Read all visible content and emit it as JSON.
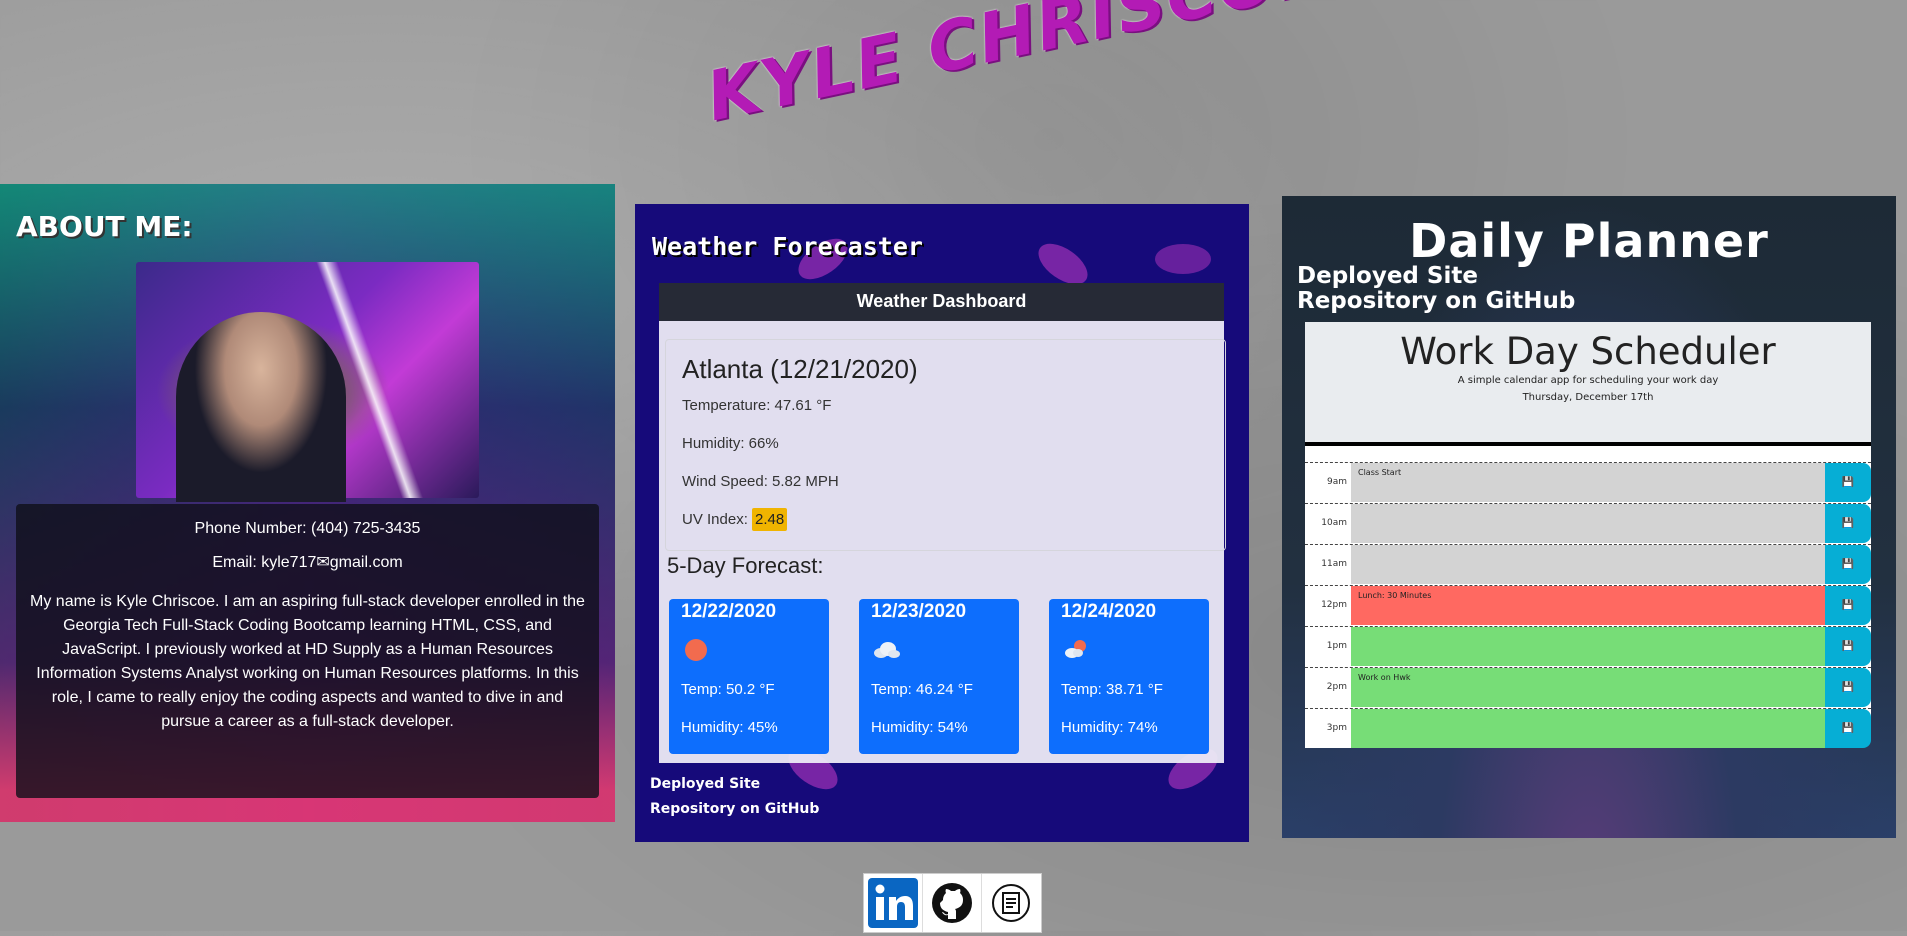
{
  "site": {
    "title": "KYLE CHRISCOE"
  },
  "about": {
    "heading": "ABOUT ME:",
    "phone": "Phone Number: (404) 725-3435",
    "email": "Email: kyle717✉gmail.com",
    "bio": "My name is Kyle Chriscoe. I am an aspiring full-stack developer enrolled in the Georgia Tech Full-Stack Coding Bootcamp learning HTML, CSS, and JavaScript. I previously worked at HD Supply as a Human Resources Information Systems Analyst working on Human Resources platforms. In this role, I came to really enjoy the coding aspects and wanted to dive in and pursue a career as a full-stack developer."
  },
  "weather": {
    "heading": "Weather Forecaster",
    "dashboard_title": "Weather Dashboard",
    "city_date": "Atlanta (12/21/2020)",
    "temperature": "Temperature: 47.61 °F",
    "humidity": "Humidity: 66%",
    "wind": "Wind Speed: 5.82 MPH",
    "uv_label": "UV Index:",
    "uv_value": "2.48",
    "uv_color": "#f0b400",
    "five_day_title": "5-Day Forecast:",
    "forecast": [
      {
        "date": "12/22/2020",
        "icon": "sun-icon",
        "temp": "Temp: 50.2 °F",
        "humidity": "Humidity: 45%"
      },
      {
        "date": "12/23/2020",
        "icon": "cloud-icon",
        "temp": "Temp: 46.24 °F",
        "humidity": "Humidity: 54%"
      },
      {
        "date": "12/24/2020",
        "icon": "partly-cloudy-icon",
        "temp": "Temp: 38.71 °F",
        "humidity": "Humidity: 74%"
      }
    ],
    "links": {
      "deployed": "Deployed Site",
      "repo": "Repository on GitHub"
    }
  },
  "planner": {
    "heading": "Daily Planner",
    "links": {
      "deployed": "Deployed Site",
      "repo": "Repository on GitHub"
    },
    "scheduler": {
      "title": "Work Day Scheduler",
      "subtitle": "A simple calendar app for scheduling your work day",
      "date": "Thursday, December 17th",
      "rows": [
        {
          "hour": "9am",
          "text": "Class Start",
          "state": "past"
        },
        {
          "hour": "10am",
          "text": "",
          "state": "past"
        },
        {
          "hour": "11am",
          "text": "",
          "state": "past"
        },
        {
          "hour": "12pm",
          "text": "Lunch: 30 Minutes",
          "state": "present"
        },
        {
          "hour": "1pm",
          "text": "",
          "state": "future"
        },
        {
          "hour": "2pm",
          "text": "Work on Hwk",
          "state": "future"
        },
        {
          "hour": "3pm",
          "text": "",
          "state": "future"
        }
      ]
    }
  },
  "social": [
    {
      "icon": "linkedin-icon"
    },
    {
      "icon": "github-icon"
    },
    {
      "icon": "resume-icon"
    }
  ],
  "colors": {
    "title": "#b31bb5",
    "weather_bg": "#160a7a",
    "forecast_card": "#0d6efd",
    "save_button": "#06aed5",
    "past": "#d3d3d3",
    "present": "#ff6961",
    "future": "#77dd77"
  }
}
